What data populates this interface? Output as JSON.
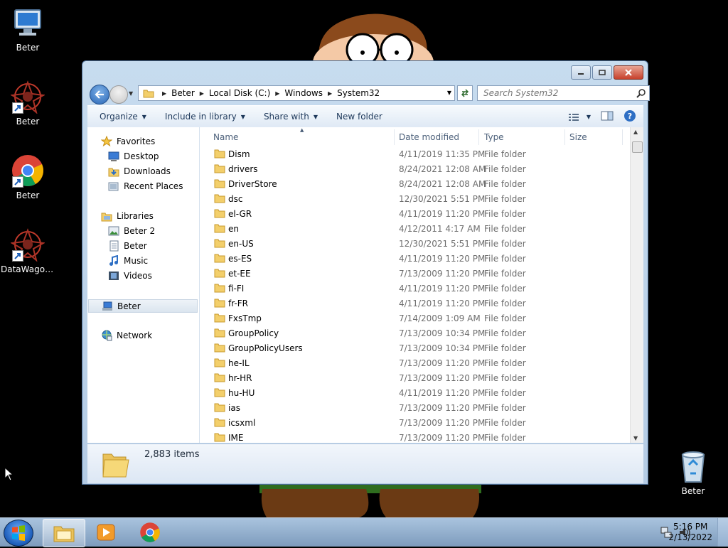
{
  "desktop": {
    "icons": [
      {
        "label": "Beter",
        "icon": "computer-icon"
      },
      {
        "label": "Beter",
        "icon": "datawagon-icon"
      },
      {
        "label": "Beter",
        "icon": "chrome-icon"
      },
      {
        "label": "DataWagon...",
        "icon": "datawagon-icon"
      }
    ],
    "recycle_bin": {
      "label": "Beter",
      "icon": "recycle-bin-icon"
    }
  },
  "window": {
    "address": {
      "crumbs": [
        "Beter",
        "Local Disk (C:)",
        "Windows",
        "System32"
      ]
    },
    "search": {
      "placeholder": "Search System32"
    },
    "toolbar": {
      "organize": "Organize",
      "include_in_library": "Include in library",
      "share_with": "Share with",
      "new_folder": "New folder"
    },
    "nav_pane": {
      "favorites": "Favorites",
      "desktop": "Desktop",
      "downloads": "Downloads",
      "recent_places": "Recent Places",
      "libraries": "Libraries",
      "beter2": "Beter 2",
      "beter_lib": "Beter",
      "music": "Music",
      "videos": "Videos",
      "homegroup": "Beter",
      "network": "Network"
    },
    "columns": {
      "name": "Name",
      "date_modified": "Date modified",
      "type": "Type",
      "size": "Size"
    },
    "files": [
      {
        "name": "Dism",
        "date": "4/11/2019 11:35 PM",
        "type": "File folder"
      },
      {
        "name": "drivers",
        "date": "8/24/2021 12:08 AM",
        "type": "File folder"
      },
      {
        "name": "DriverStore",
        "date": "8/24/2021 12:08 AM",
        "type": "File folder"
      },
      {
        "name": "dsc",
        "date": "12/30/2021 5:51 PM",
        "type": "File folder"
      },
      {
        "name": "el-GR",
        "date": "4/11/2019 11:20 PM",
        "type": "File folder"
      },
      {
        "name": "en",
        "date": "4/12/2011 4:17 AM",
        "type": "File folder"
      },
      {
        "name": "en-US",
        "date": "12/30/2021 5:51 PM",
        "type": "File folder"
      },
      {
        "name": "es-ES",
        "date": "4/11/2019 11:20 PM",
        "type": "File folder"
      },
      {
        "name": "et-EE",
        "date": "7/13/2009 11:20 PM",
        "type": "File folder"
      },
      {
        "name": "fi-FI",
        "date": "4/11/2019 11:20 PM",
        "type": "File folder"
      },
      {
        "name": "fr-FR",
        "date": "4/11/2019 11:20 PM",
        "type": "File folder"
      },
      {
        "name": "FxsTmp",
        "date": "7/14/2009 1:09 AM",
        "type": "File folder"
      },
      {
        "name": "GroupPolicy",
        "date": "7/13/2009 10:34 PM",
        "type": "File folder"
      },
      {
        "name": "GroupPolicyUsers",
        "date": "7/13/2009 10:34 PM",
        "type": "File folder"
      },
      {
        "name": "he-IL",
        "date": "7/13/2009 11:20 PM",
        "type": "File folder"
      },
      {
        "name": "hr-HR",
        "date": "7/13/2009 11:20 PM",
        "type": "File folder"
      },
      {
        "name": "hu-HU",
        "date": "4/11/2019 11:20 PM",
        "type": "File folder"
      },
      {
        "name": "ias",
        "date": "7/13/2009 11:20 PM",
        "type": "File folder"
      },
      {
        "name": "icsxml",
        "date": "7/13/2009 11:20 PM",
        "type": "File folder"
      },
      {
        "name": "IME",
        "date": "7/13/2009 11:20 PM",
        "type": "File folder"
      }
    ],
    "details": {
      "item_count": "2,883 items"
    }
  },
  "taskbar": {
    "time": "5:16 PM",
    "date": "2/13/2022"
  }
}
